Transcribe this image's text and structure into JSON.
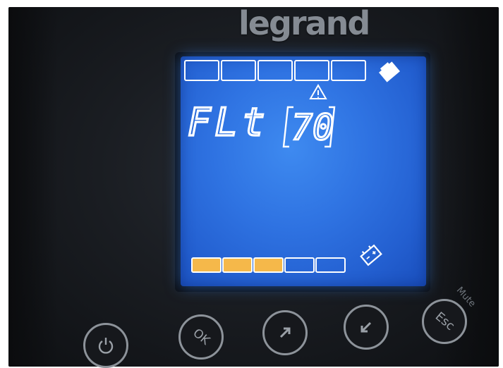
{
  "brand": {
    "logo_text": "legrand"
  },
  "display": {
    "code": "FLt",
    "value": "70",
    "warning_icon": "warning-triangle-icon",
    "load_icon": "load-icon",
    "battery_icon": "battery-icon",
    "top_bar_segments": 5,
    "top_bar_filled": 0,
    "bottom_bar_segments": 5,
    "bottom_bar_filled": 3,
    "backlight_color": "#2f73e2",
    "segment_color": "#ffffff",
    "filled_color": "#f5b84a"
  },
  "controls": {
    "mute_label": "Mute",
    "buttons": [
      {
        "icon": "power-icon",
        "label": ""
      },
      {
        "icon": "",
        "label": "OK"
      },
      {
        "icon": "arrow-up-icon",
        "label": ""
      },
      {
        "icon": "arrow-down-icon",
        "label": ""
      },
      {
        "icon": "",
        "label": "Esc"
      }
    ]
  }
}
